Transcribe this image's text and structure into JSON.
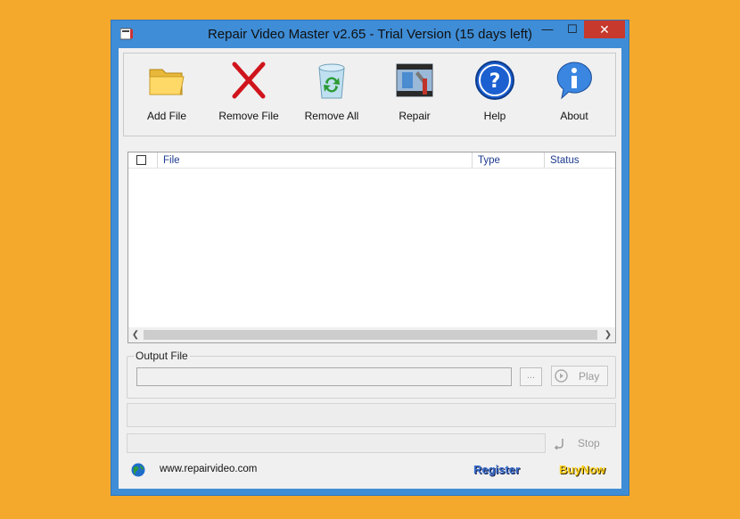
{
  "window": {
    "title": "Repair Video Master v2.65 - Trial Version (15 days left)",
    "minimize": "—",
    "maximize": "☐",
    "close": "✕"
  },
  "toolbar": {
    "items": [
      {
        "label": "Add File",
        "icon": "folder-icon"
      },
      {
        "label": "Remove File",
        "icon": "red-x-icon"
      },
      {
        "label": "Remove All",
        "icon": "recycle-bin-icon"
      },
      {
        "label": "Repair",
        "icon": "film-tools-icon"
      },
      {
        "label": "Help",
        "icon": "help-icon"
      },
      {
        "label": "About",
        "icon": "info-icon"
      }
    ]
  },
  "file_list": {
    "columns": [
      "File",
      "Type",
      "Status"
    ],
    "rows": []
  },
  "output": {
    "group_label": "Output File",
    "value": "",
    "browse_label": "...",
    "play_label": "Play"
  },
  "progress": {
    "stop_label": "Stop"
  },
  "footer": {
    "website": "www.repairvideo.com",
    "register": "Register",
    "buynow": "BuyNow"
  },
  "colors": {
    "background": "#f5a92c",
    "titlebar": "#3f8dd6",
    "close": "#c7392c",
    "header_text": "#1c3a8e"
  }
}
